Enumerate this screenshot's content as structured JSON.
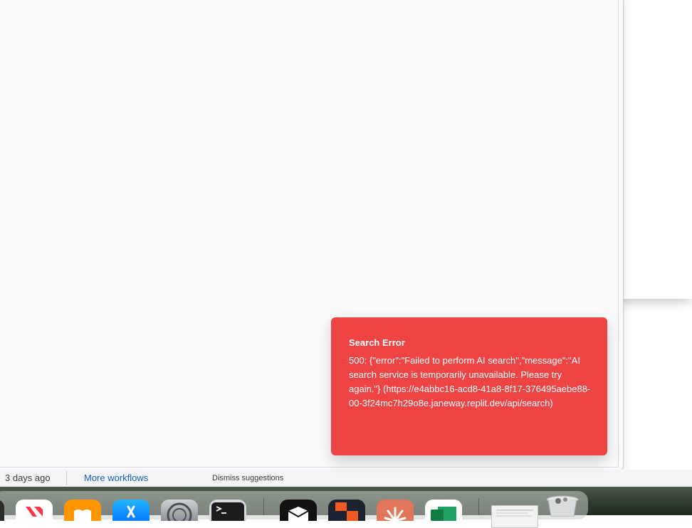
{
  "toast": {
    "title": "Search Error",
    "message": "500: {\"error\":\"Failed to perform AI search\",\"message\":\"AI search service is temporarily unavailable. Please try again.\"} (https://e4abbc16-acd8-41a8-8f17-376495aebe88-00-3f24mc7h29o8e.janeway.replit.dev/api/search)"
  },
  "bottom_bar": {
    "last_updated": "3 days ago",
    "more_workflows": "More workflows",
    "dismiss_suggestions": "Dismiss suggestions"
  },
  "dock": {
    "icons": [
      "news-app-icon",
      "books-app-icon",
      "app-store-icon",
      "system-settings-icon",
      "terminal-icon",
      "mail-app-icon",
      "office-app-icon",
      "claude-app-icon",
      "excel-app-icon",
      "document-preview-icon",
      "trash-icon"
    ]
  },
  "colors": {
    "toast_bg": "#ef4444",
    "link": "#1a5fb4"
  }
}
